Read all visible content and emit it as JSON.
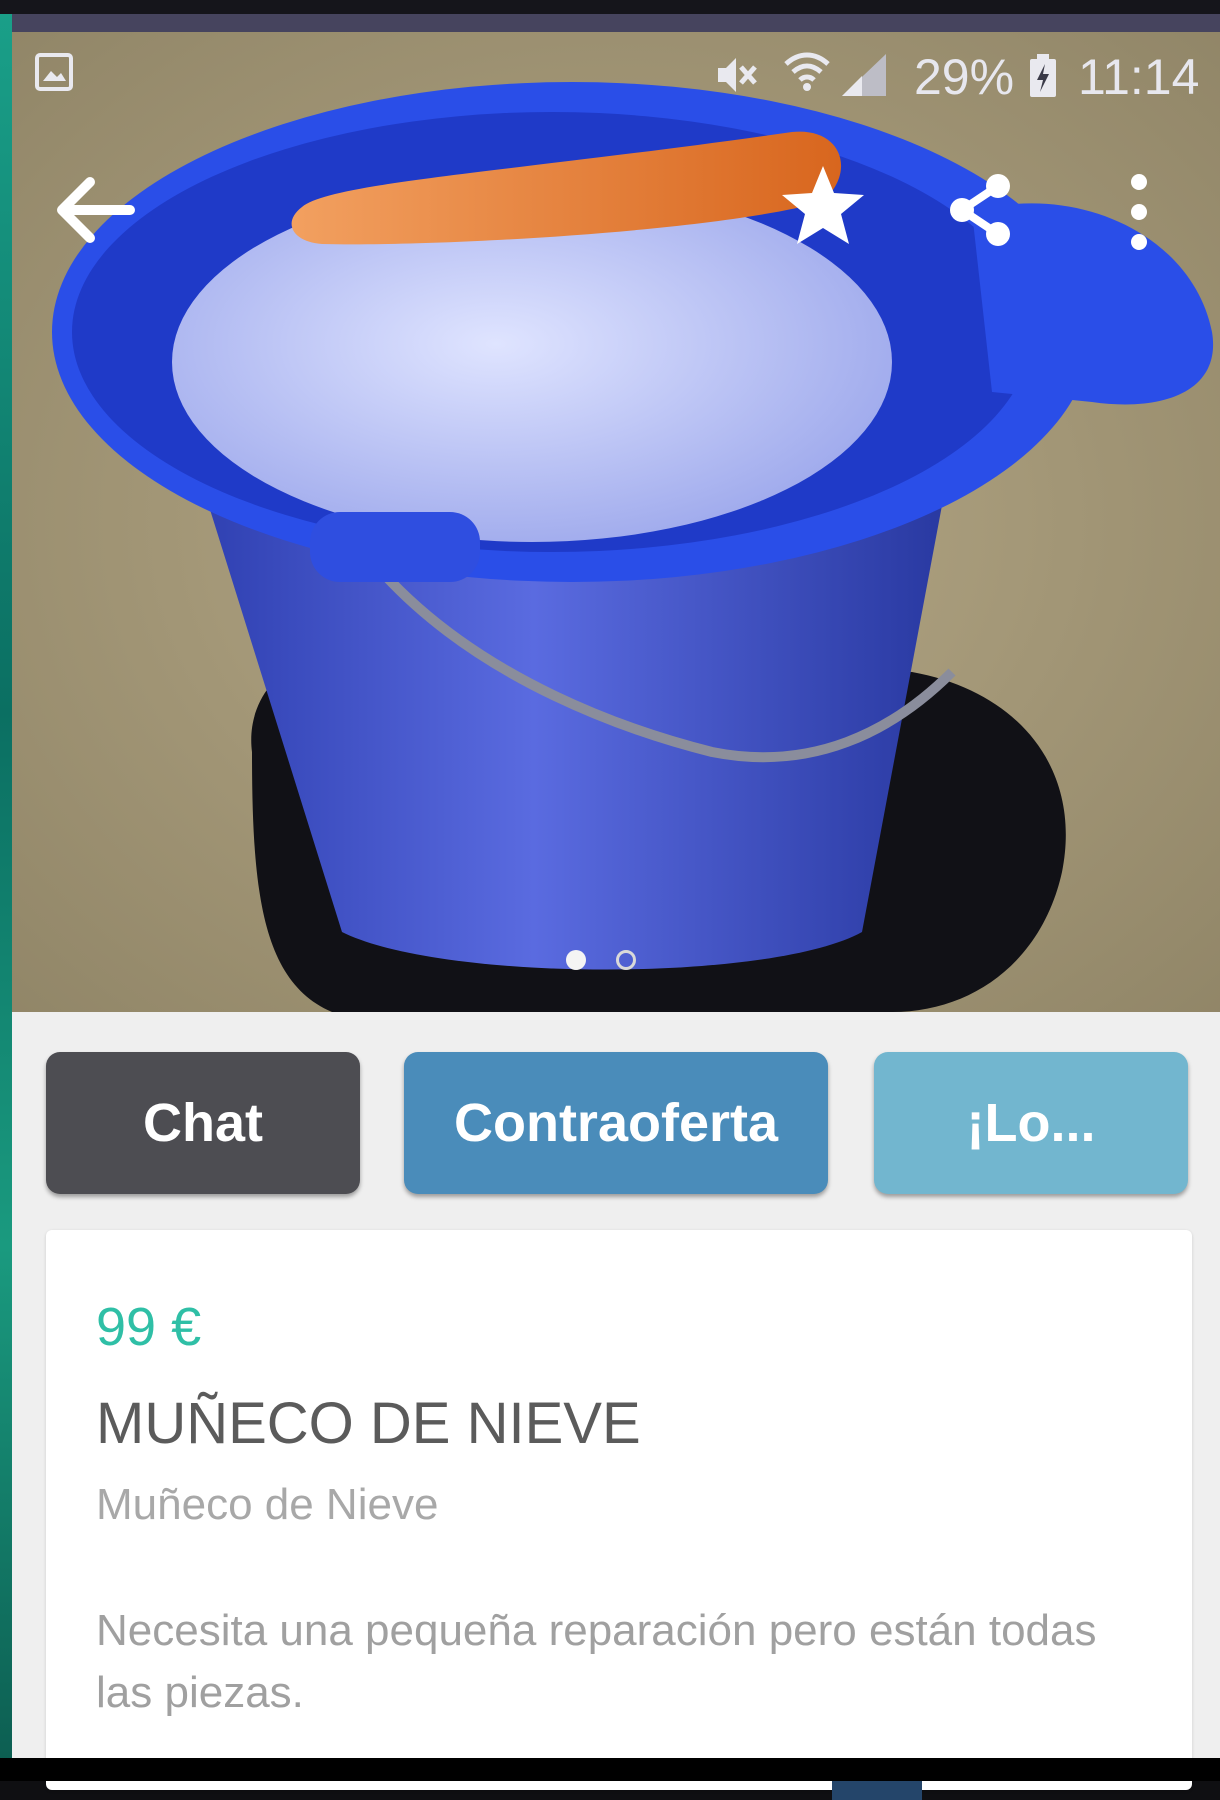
{
  "status_bar": {
    "battery_percent": "29%",
    "time": "11:14",
    "icons": [
      "gallery-icon",
      "mute-icon",
      "wifi-icon",
      "signal-icon",
      "battery-charging-icon"
    ]
  },
  "app_bar": {
    "icons": [
      "back-arrow-icon",
      "star-icon",
      "share-icon",
      "more-vert-icon"
    ]
  },
  "photo": {
    "carousel_total": 2,
    "carousel_active": 1
  },
  "actions": {
    "chat_label": "Chat",
    "counter_offer_label": "Contraoferta",
    "buy_label": "¡Lo..."
  },
  "listing": {
    "price": "99 €",
    "title": "MUÑECO DE NIEVE",
    "category": "Muñeco de Nieve",
    "description": "Necesita una pequeña reparación pero están todas las piezas."
  },
  "colors": {
    "price": "#2fbfa6",
    "chat_button": "#4d4d52",
    "counter_offer_button": "#4a8cba",
    "buy_button": "#72b6cf"
  }
}
